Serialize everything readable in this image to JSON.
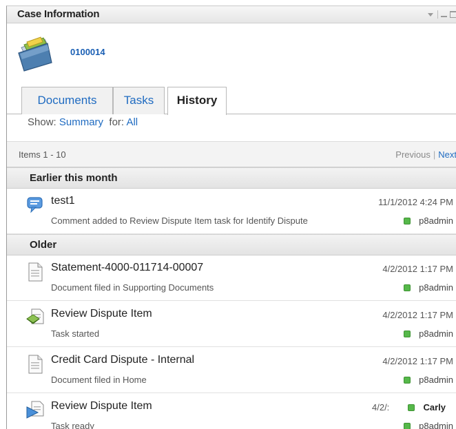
{
  "panel": {
    "title": "Case Information"
  },
  "case": {
    "id": "0100014",
    "icon": "folder-icon"
  },
  "tabs": [
    {
      "label": "Documents",
      "active": false
    },
    {
      "label": "Tasks",
      "active": false
    },
    {
      "label": "History",
      "active": true
    }
  ],
  "filter": {
    "show_label": "Show:",
    "show_value": "Summary",
    "for_label": "for:",
    "for_value": "All"
  },
  "pagination": {
    "items": "Items 1 - 10",
    "previous": "Previous",
    "separator": "|",
    "next": "Next"
  },
  "groups": [
    {
      "label": "Earlier this month",
      "entries": [
        {
          "icon": "comment-icon",
          "name": "test1",
          "description": "Comment added to Review Dispute Item task for Identify Dispute",
          "date": "11/1/2012 4:24 PM",
          "user": "p8admin"
        }
      ]
    },
    {
      "label": "Older",
      "entries": [
        {
          "icon": "document-icon",
          "name": "Statement-4000-011714-00007",
          "description": "Document filed in Supporting Documents",
          "date": "4/2/2012 1:17 PM",
          "user": "p8admin"
        },
        {
          "icon": "task-started-icon",
          "name": "Review Dispute Item",
          "description": "Task started",
          "date": "4/2/2012 1:17 PM",
          "user": "p8admin"
        },
        {
          "icon": "document-icon",
          "name": "Credit Card Dispute - Internal",
          "description": "Document filed in Home",
          "date": "4/2/2012 1:17 PM",
          "user": "p8admin"
        },
        {
          "icon": "task-ready-icon",
          "name": "Review Dispute Item",
          "description": "Task ready",
          "date_truncated": "4/2/:",
          "hover_user": "Carly",
          "user": "p8admin"
        }
      ]
    }
  ],
  "colors": {
    "link": "#1f6bc1",
    "presence": "#56b84a"
  }
}
